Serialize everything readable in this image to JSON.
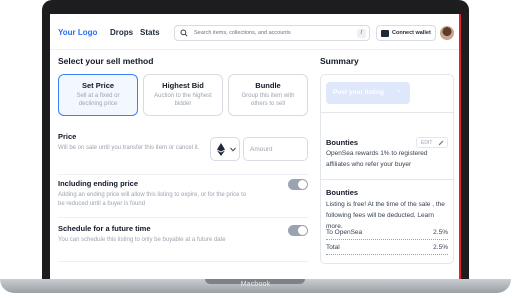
{
  "nav": {
    "logo": "Your Logo",
    "links": [
      "Drops",
      "Stats"
    ],
    "search_placeholder": "Search items, collections, and accounts",
    "shortcut": "/",
    "wallet_label": "Connect wallet"
  },
  "sell": {
    "title": "Select your sell method",
    "methods": [
      {
        "title": "Set Price",
        "desc": "Sell at a fixed or declining price",
        "active": true
      },
      {
        "title": "Highest Bid",
        "desc": "Auction to the highest bidder",
        "active": false
      },
      {
        "title": "Bundle",
        "desc": "Group this item with others to sell",
        "active": false
      }
    ],
    "price": {
      "title": "Price",
      "desc": "Will be on sale until you transfer this item or cancel it.",
      "currency_icon": "ethereum-icon",
      "amount_placeholder": "Amount"
    },
    "ending_price": {
      "title": "Including ending price",
      "desc": "Adding an ending price will allow this listing to expire, or for the price to be reduced until a buyer is found",
      "enabled": false
    },
    "schedule": {
      "title": "Schedule for a future time",
      "desc": "You can schedule this listing to only be buyable at a future date",
      "enabled": false
    }
  },
  "summary": {
    "title": "Summary",
    "post_label": "Post your listing",
    "bounties": {
      "title": "Bounties",
      "edit_label": "EDIT",
      "text": "OpenSea rewards 1% to registered affiliates who refer your buyer"
    },
    "fees": {
      "title": "Bounties",
      "text": "Listing is free! At the time of the sale , the following fees will be deducted. Learn more.",
      "rows": [
        {
          "label": "To OpenSea",
          "value": "2.5%"
        },
        {
          "label": "Total",
          "value": "2.5%"
        }
      ]
    }
  },
  "device": {
    "brand": "Macbook"
  },
  "colors": {
    "accent": "#2a6df4",
    "post_button_disabled": "#dfe7fb",
    "frame": "#1d1d1f"
  }
}
